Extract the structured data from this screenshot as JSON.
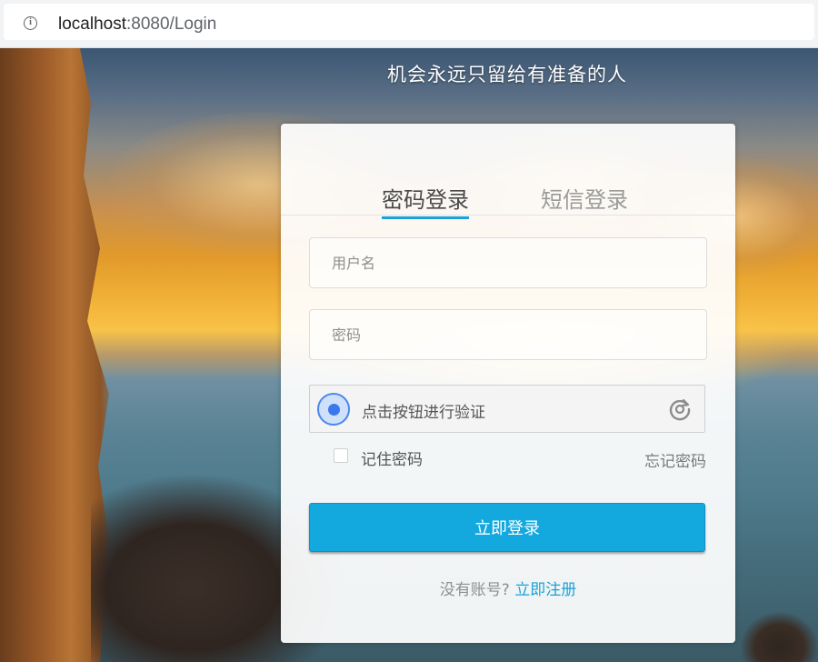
{
  "browser": {
    "url_host": "localhost",
    "url_rest": ":8080/Login"
  },
  "page": {
    "slogan": "机会永远只留给有准备的人"
  },
  "login": {
    "tabs": [
      {
        "label": "密码登录",
        "active": true
      },
      {
        "label": "短信登录",
        "active": false
      }
    ],
    "username_placeholder": "用户名",
    "password_placeholder": "密码",
    "captcha_text": "点击按钮进行验证",
    "remember_label": "记住密码",
    "remember_checked": false,
    "forgot_label": "忘记密码",
    "submit_label": "立即登录",
    "register_prefix": "没有账号?",
    "register_link": "立即注册"
  },
  "colors": {
    "accent": "#13a9df",
    "link": "#1aa1d8",
    "captcha_blue": "#3b78ea"
  },
  "icons": {
    "info": "info-icon",
    "captcha": "captcha-circle-icon",
    "refresh": "refresh-icon"
  }
}
